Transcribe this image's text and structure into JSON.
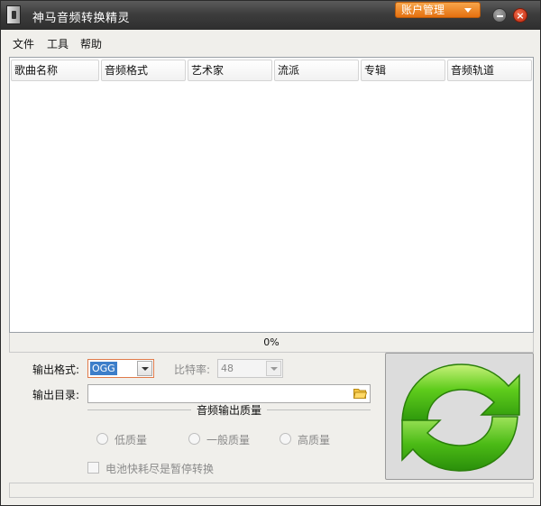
{
  "window": {
    "title": "神马音频转换精灵",
    "account_menu_label": "账户管理"
  },
  "menu": {
    "items": [
      {
        "label": "文件"
      },
      {
        "label": "工具"
      },
      {
        "label": "帮助"
      }
    ]
  },
  "song_list": {
    "columns": [
      {
        "label": "歌曲名称"
      },
      {
        "label": "音频格式"
      },
      {
        "label": "艺术家"
      },
      {
        "label": "流派"
      },
      {
        "label": "专辑"
      },
      {
        "label": "音频轨道"
      }
    ],
    "rows": []
  },
  "progress": {
    "text": "0%",
    "value": 0
  },
  "settings": {
    "format_label": "输出格式:",
    "format_value": "OGG",
    "bitrate_label": "比特率:",
    "bitrate_value": "48",
    "dir_label": "输出目录:",
    "dir_value": "",
    "quality_title": "音频输出质量",
    "quality_options": [
      {
        "label": "低质量"
      },
      {
        "label": "一般质量"
      },
      {
        "label": "高质量"
      }
    ],
    "battery_pause_label": "电池快耗尽是暂停转换"
  },
  "colors": {
    "title_bar": "#3d3d3d",
    "account_button": "#f08c2a",
    "convert_arrow_green": "#4fbf1c",
    "format_focus_border": "#e07a4a"
  },
  "icons": {
    "app": "audio-file-icon",
    "folder": "folder-open-icon",
    "convert": "refresh-arrows-icon"
  }
}
